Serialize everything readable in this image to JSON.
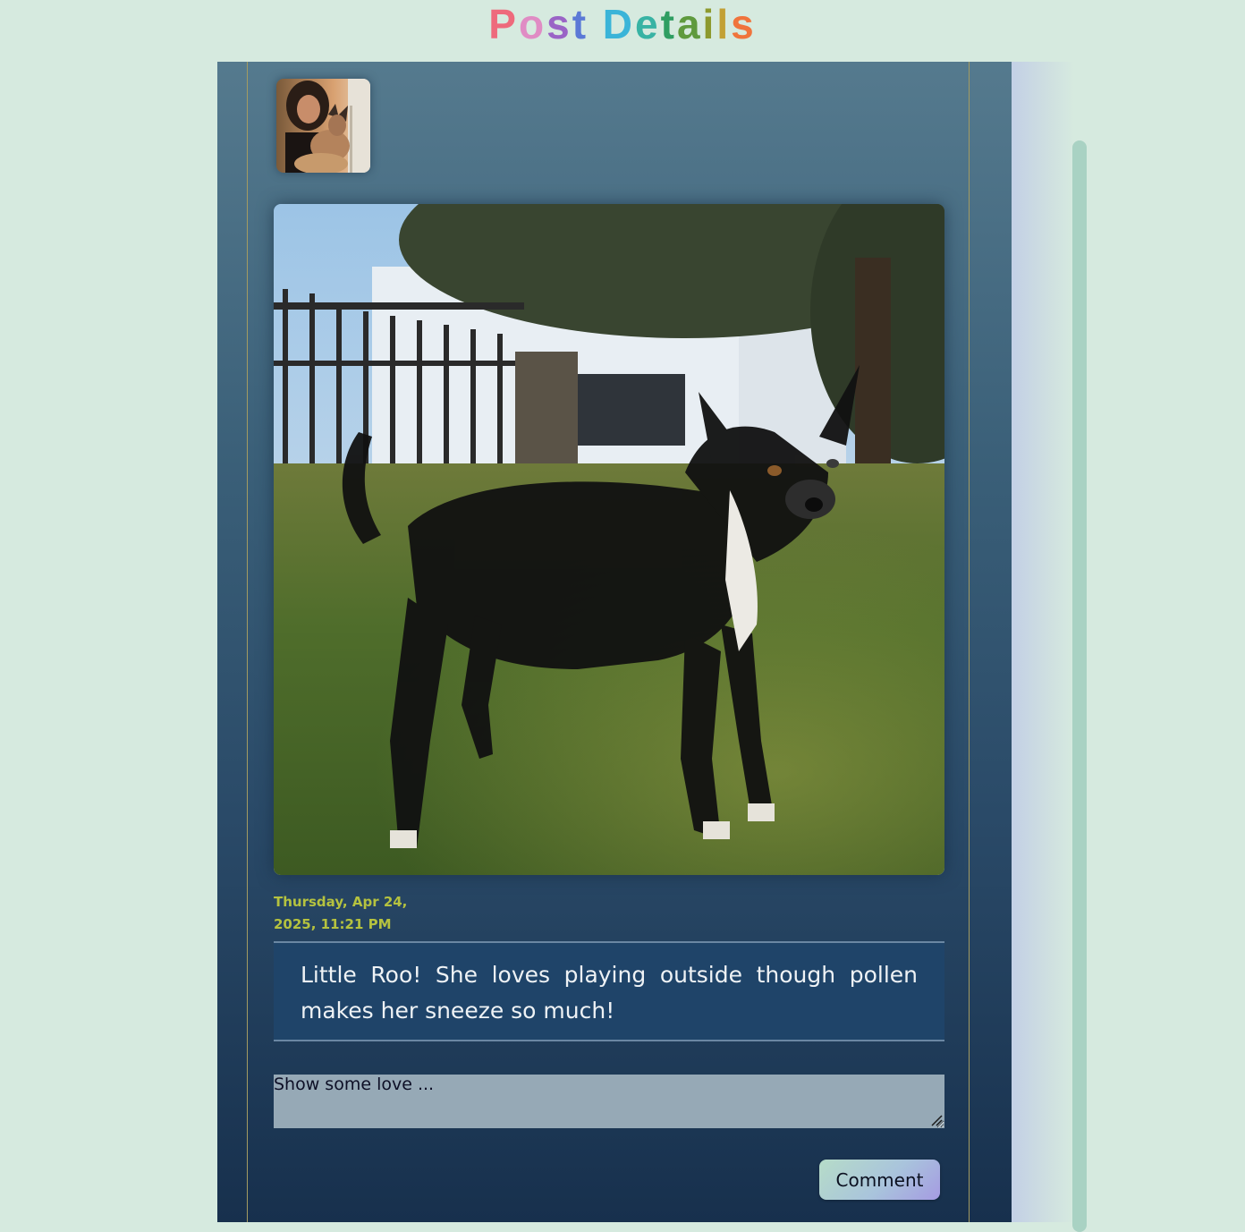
{
  "page": {
    "title_letters": [
      {
        "ch": "P",
        "color": "#ee6a7c"
      },
      {
        "ch": "o",
        "color": "#e08cc4"
      },
      {
        "ch": "s",
        "color": "#9a64c6"
      },
      {
        "ch": "t",
        "color": "#5b79d6"
      },
      {
        "ch": " ",
        "color": "#000000"
      },
      {
        "ch": "D",
        "color": "#3ab4d8"
      },
      {
        "ch": "e",
        "color": "#38b3a4"
      },
      {
        "ch": "t",
        "color": "#2f9e62"
      },
      {
        "ch": "a",
        "color": "#5f9a3e"
      },
      {
        "ch": "i",
        "color": "#8d9a2e"
      },
      {
        "ch": "l",
        "color": "#c2a035"
      },
      {
        "ch": "s",
        "color": "#f0743c"
      }
    ]
  },
  "post": {
    "avatar_icon": "user-avatar-photo",
    "image_icon": "dog-photo",
    "timestamp": "Thursday, Apr 24, 2025, 11:21 PM",
    "caption": "Little Roo! She loves playing outside though pollen makes her sneeze so much!"
  },
  "comment_form": {
    "placeholder": "Show some love ...",
    "value": "",
    "submit_label": "Comment"
  },
  "colors": {
    "background": "#d6eadf",
    "timestamp": "#b5c23f",
    "caption_bg": "#1f4469",
    "input_bg": "#96a9b6"
  }
}
